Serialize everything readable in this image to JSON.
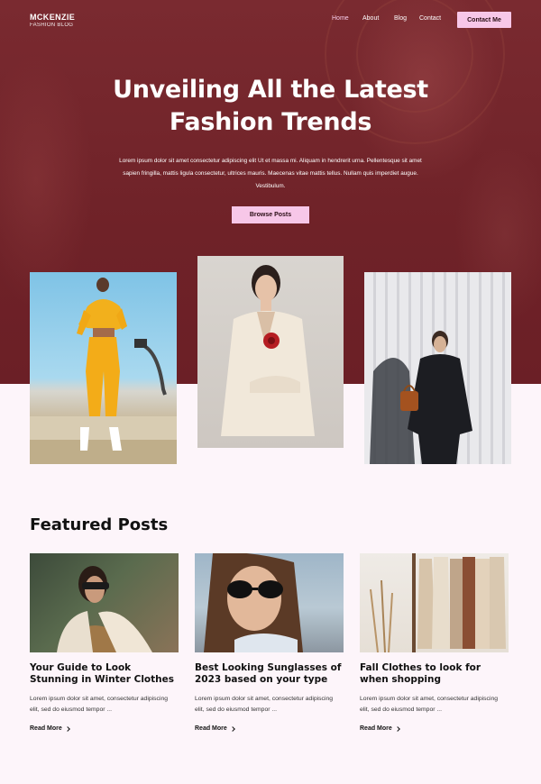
{
  "brand": {
    "name": "MCKENZIE",
    "tagline": "FASHION BLOG"
  },
  "nav": {
    "items": [
      {
        "label": "Home",
        "active": true
      },
      {
        "label": "About",
        "active": false
      },
      {
        "label": "Blog",
        "active": false
      },
      {
        "label": "Contact",
        "active": false
      }
    ],
    "cta_label": "Contact Me"
  },
  "hero": {
    "title_line1": "Unveiling All the Latest",
    "title_line2": "Fashion Trends",
    "description": "Lorem ipsum dolor sit amet consectetur adipiscing elit Ut et massa mi. Aliquam in hendrerit urna. Pellentesque sit amet sapien fringilla, mattis ligula consectetur, ultrices mauris. Maecenas vitae mattis tellus. Nullam quis imperdiet augue. Vestibulum.",
    "button_label": "Browse Posts"
  },
  "featured": {
    "heading": "Featured Posts",
    "posts": [
      {
        "title": "Your Guide to Look Stunning in Winter Clothes",
        "excerpt": "Lorem ipsum dolor sit amet, consectetur adipiscing elit, sed do eiusmod tempor ...",
        "link_label": "Read More"
      },
      {
        "title": "Best Looking Sunglasses of 2023 based on your type",
        "excerpt": "Lorem ipsum dolor sit amet, consectetur adipiscing elit, sed do eiusmod tempor ...",
        "link_label": "Read More"
      },
      {
        "title": "Fall Clothes to look for when shopping",
        "excerpt": "Lorem ipsum dolor sit amet, consectetur adipiscing elit, sed do eiusmod tempor ...",
        "link_label": "Read More"
      }
    ]
  },
  "colors": {
    "hero_bg": "#6f2228",
    "accent_pink": "#f7c7e8",
    "page_bg": "#fdf5fa"
  }
}
